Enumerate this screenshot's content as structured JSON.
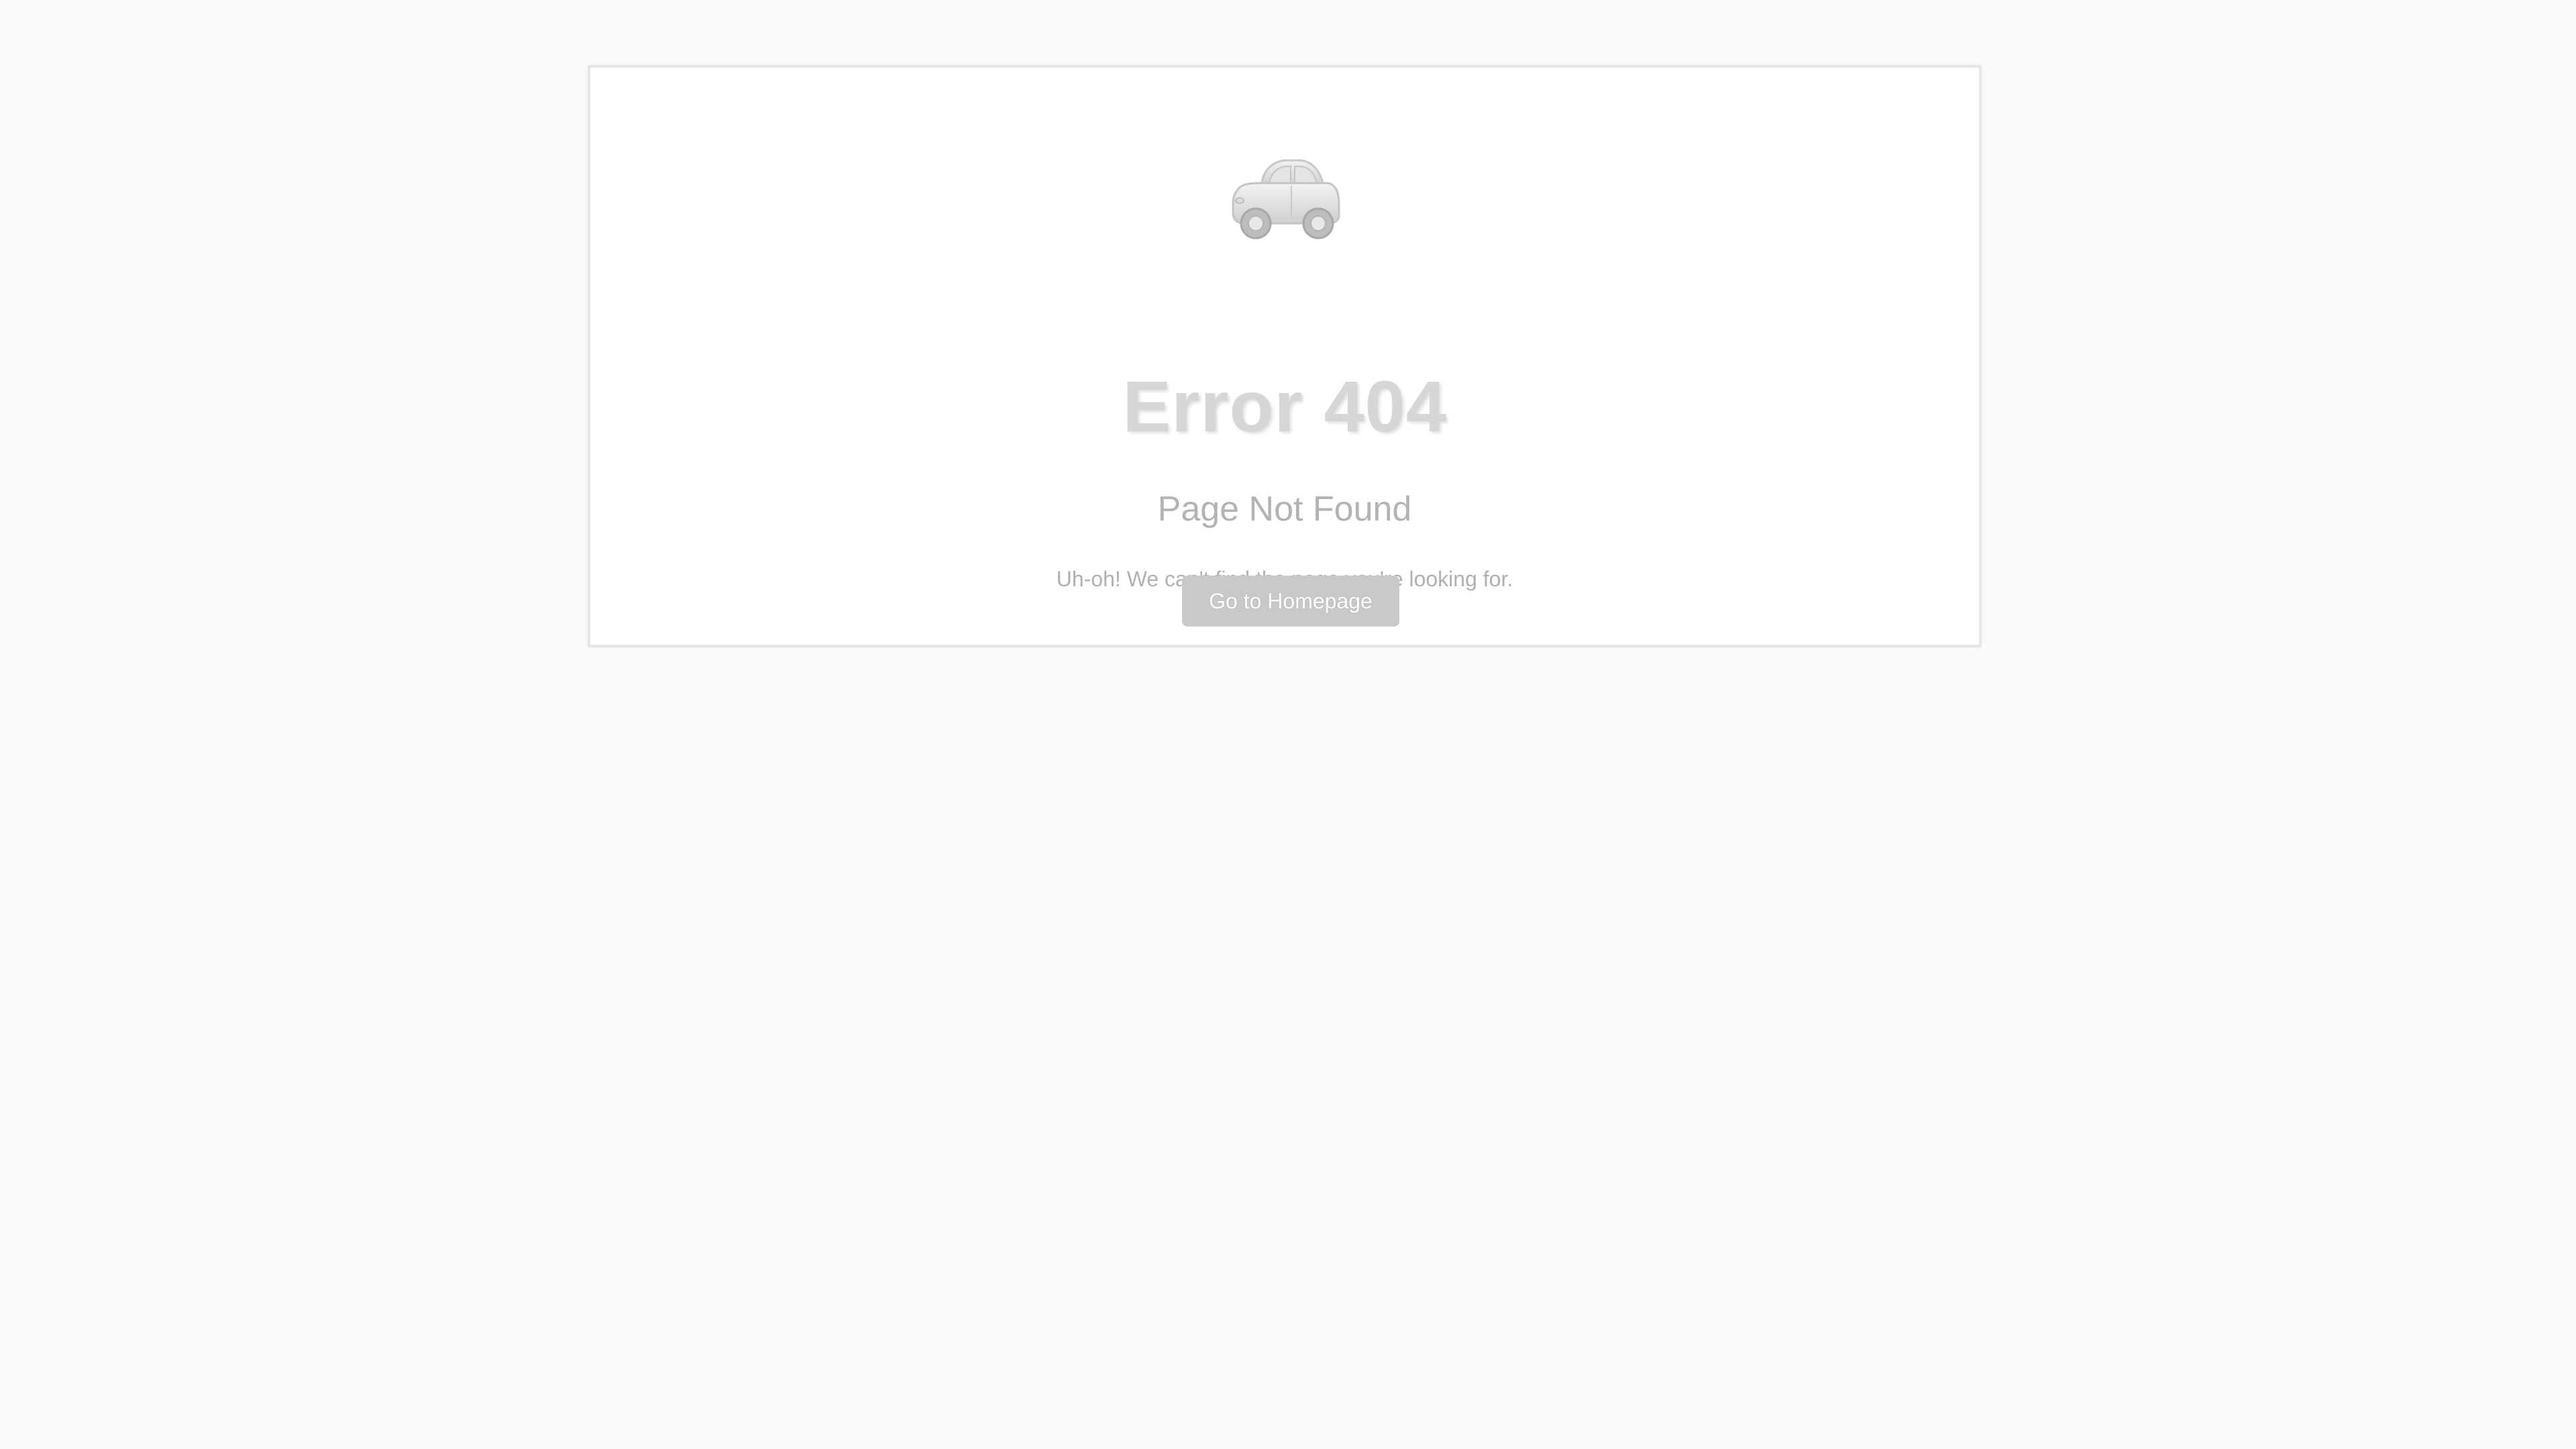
{
  "error": {
    "icon": "car-icon",
    "title": "Error 404",
    "subtitle": "Page Not Found",
    "message": "Uh-oh! We can't find the page you're looking for.",
    "button_label": "Go to Homepage"
  },
  "colors": {
    "background": "#fafafa",
    "card": "#ffffff",
    "title": "#d6d6d6",
    "button": "#c9c9c9"
  }
}
